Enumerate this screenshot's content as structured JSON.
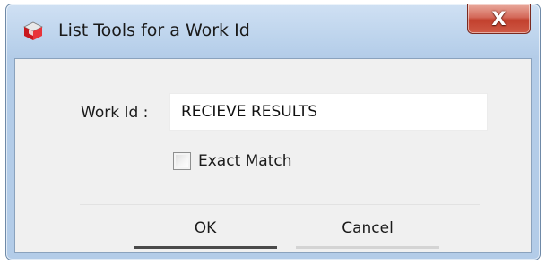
{
  "window": {
    "title": "List Tools for a Work Id",
    "close_glyph": "X",
    "icon": "app-cube-icon"
  },
  "form": {
    "work_id_label": "Work Id :",
    "work_id_value": "RECIEVE RESULTS",
    "exact_match_label": "Exact Match",
    "exact_match_checked": false
  },
  "buttons": {
    "ok_label": "OK",
    "cancel_label": "Cancel"
  },
  "colors": {
    "title_bar": "#bcd3ec",
    "close_button": "#c2402d",
    "client_background": "#f0f0f0"
  }
}
